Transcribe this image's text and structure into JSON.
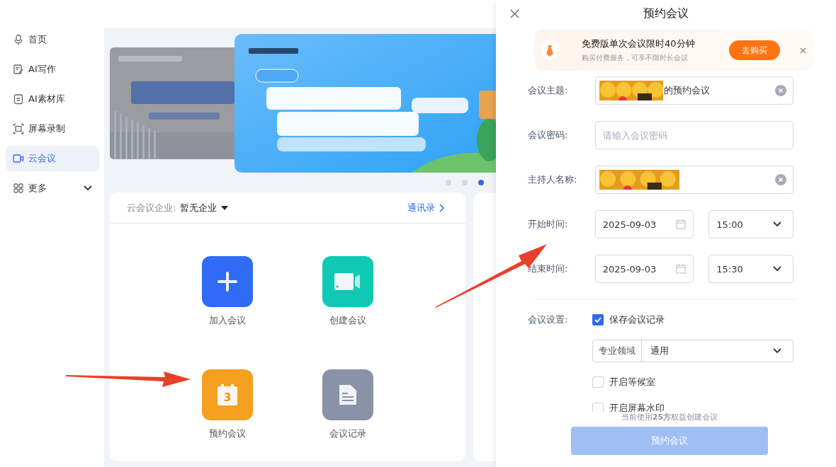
{
  "sidebar": {
    "items": [
      {
        "label": "首页",
        "selected": false
      },
      {
        "label": "AI写作",
        "selected": false
      },
      {
        "label": "AI素材库",
        "selected": false
      },
      {
        "label": "屏幕录制",
        "selected": false
      },
      {
        "label": "云会议",
        "selected": true
      },
      {
        "label": "更多",
        "selected": false,
        "expandable": true
      }
    ]
  },
  "carousel": {
    "dots": [
      {
        "selected": false
      },
      {
        "selected": false
      },
      {
        "selected": true
      }
    ]
  },
  "meeting_card": {
    "enterprise_label": "云会议企业:",
    "enterprise_value": "暂无企业",
    "contacts_link": "通讯录",
    "actions": [
      {
        "label": "加入会议",
        "kind": "join",
        "color": "#2f6bf5"
      },
      {
        "label": "创建会议",
        "kind": "create",
        "color": "#10c9b4"
      },
      {
        "label": "预约会议",
        "kind": "schedule",
        "color": "#f5a020",
        "icon_text": "3"
      },
      {
        "label": "会议记录",
        "kind": "records",
        "color": "#8a92a8"
      }
    ]
  },
  "annotations": [
    {
      "kind": "arrow"
    },
    {
      "kind": "arrow"
    }
  ],
  "dialog": {
    "title": "预约会议",
    "promo": {
      "title": "免费版单次会议限时40分钟",
      "subtitle": "购买付费服务，可享不限时长会议",
      "button": "去购买"
    },
    "fields": [
      {
        "label": "会议主题:",
        "kind": "text",
        "has_picture": true,
        "value": "的预约会议",
        "clearable": true
      },
      {
        "label": "会议密码:",
        "kind": "text",
        "placeholder": "请输入会议密码",
        "clearable": false
      },
      {
        "label": "主持人名称:",
        "kind": "text",
        "has_picture": true,
        "clearable": true
      },
      {
        "label": "开始时间:",
        "kind": "datetime",
        "date": "2025-09-03",
        "time": "15:00"
      },
      {
        "label": "结束时间:",
        "kind": "datetime",
        "date": "2025-09-03",
        "time": "15:30"
      }
    ],
    "settings_label": "会议设置:",
    "settings": [
      {
        "kind": "checkbox",
        "label": "保存会议记录",
        "checked": true
      },
      {
        "kind": "select",
        "addon": "专业领域",
        "value": "通用"
      },
      {
        "kind": "checkbox",
        "label": "开启等候室",
        "checked": false
      },
      {
        "kind": "checkbox",
        "label": "开启屏幕水印",
        "checked": false
      }
    ],
    "footnote": "当前使用**25方**权益创建会议",
    "submit": {
      "label": "预约会议",
      "disabled": true
    }
  }
}
